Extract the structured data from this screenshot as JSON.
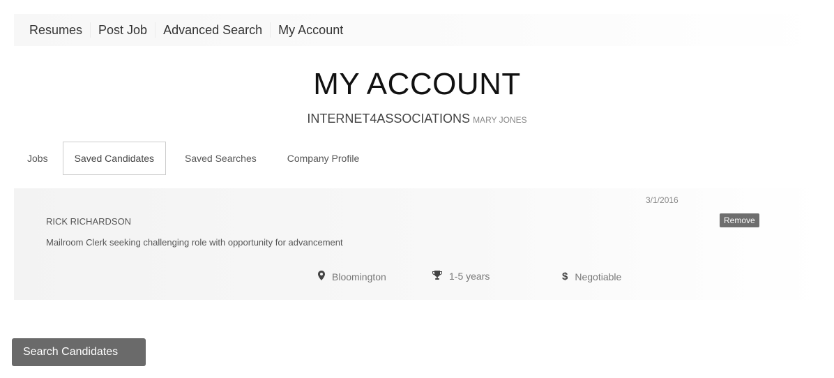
{
  "nav": {
    "items": [
      {
        "label": "Resumes"
      },
      {
        "label": "Post Job"
      },
      {
        "label": "Advanced Search"
      },
      {
        "label": "My Account"
      }
    ]
  },
  "header": {
    "title": "MY ACCOUNT",
    "organization": "INTERNET4ASSOCIATIONS",
    "user": "MARY JONES"
  },
  "tabs": [
    {
      "label": "Jobs",
      "active": false
    },
    {
      "label": "Saved Candidates",
      "active": true
    },
    {
      "label": "Saved Searches",
      "active": false
    },
    {
      "label": "Company Profile",
      "active": false
    }
  ],
  "candidates": [
    {
      "date": "3/1/2016",
      "remove_label": "Remove",
      "name": "RICK RICHARDSON",
      "headline": "Mailroom Clerk seeking challenging role with opportunity for advancement",
      "location": "Bloomington",
      "experience": "1-5 years",
      "salary": "Negotiable",
      "icons": {
        "location": "map-marker-icon",
        "experience": "trophy-icon",
        "salary": "dollar-icon"
      }
    }
  ],
  "actions": {
    "search_candidates_label": "Search Candidates"
  },
  "colors": {
    "button_bg": "#6a6a6a",
    "remove_bg": "#6e6e6e",
    "card_bg": "#f3f3f3"
  }
}
